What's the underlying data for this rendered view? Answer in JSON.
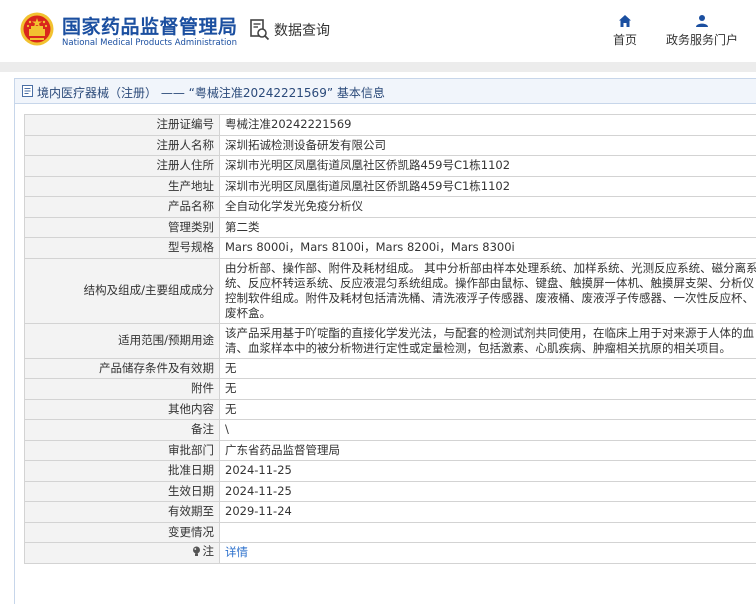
{
  "header": {
    "site_title_cn": "国家药品监督管理局",
    "site_title_en": "National Medical Products Administration",
    "query_label": "数据查询",
    "nav": [
      {
        "label": "首页",
        "icon": "home-icon"
      },
      {
        "label": "政务服务门户",
        "icon": "user-icon"
      }
    ]
  },
  "breadcrumb": {
    "text": "境内医疗器械（注册） —— “粤械注准20242221569” 基本信息"
  },
  "details": {
    "rows": [
      {
        "key": "注册证编号",
        "value": "粤械注准20242221569"
      },
      {
        "key": "注册人名称",
        "value": "深圳拓诚检测设备研发有限公司"
      },
      {
        "key": "注册人住所",
        "value": "深圳市光明区凤凰街道凤凰社区侨凯路459号C1栋1102"
      },
      {
        "key": "生产地址",
        "value": "深圳市光明区凤凰街道凤凰社区侨凯路459号C1栋1102"
      },
      {
        "key": "产品名称",
        "value": "全自动化学发光免疫分析仪"
      },
      {
        "key": "管理类别",
        "value": "第二类"
      },
      {
        "key": "型号规格",
        "value": "Mars 8000i，Mars 8100i，Mars 8200i，Mars 8300i"
      },
      {
        "key": "结构及组成/主要组成成分",
        "value": "由分析部、操作部、附件及耗材组成。 其中分析部由样本处理系统、加样系统、光测反应系统、磁分离系统、反应杯转运系统、反应液混匀系统组成。操作部由鼠标、键盘、触摸屏一体机、触摸屏支架、分析仪控制软件组成。附件及耗材包括清洗桶、清洗液浮子传感器、废液桶、废液浮子传感器、一次性反应杯、废杯盒。"
      },
      {
        "key": "适用范围/预期用途",
        "value": "该产品采用基于吖啶酯的直接化学发光法，与配套的检测试剂共同使用，在临床上用于对来源于人体的血清、血浆样本中的被分析物进行定性或定量检测，包括激素、心肌疾病、肿瘤相关抗原的相关项目。"
      },
      {
        "key": "产品储存条件及有效期",
        "value": "无"
      },
      {
        "key": "附件",
        "value": "无"
      },
      {
        "key": "其他内容",
        "value": "无"
      },
      {
        "key": "备注",
        "value": "\\"
      },
      {
        "key": "审批部门",
        "value": "广东省药品监督管理局"
      },
      {
        "key": "批准日期",
        "value": "2024-11-25"
      },
      {
        "key": "生效日期",
        "value": "2024-11-25"
      },
      {
        "key": "有效期至",
        "value": "2029-11-24"
      },
      {
        "key": "变更情况",
        "value": ""
      },
      {
        "key": "注",
        "value": "详情",
        "icon": "info-bulb-icon"
      }
    ]
  },
  "colors": {
    "brand_blue": "#1b4fa0",
    "link_blue": "#2a6fcc",
    "emblem_red": "#d9261c",
    "emblem_gold": "#f2c230"
  }
}
